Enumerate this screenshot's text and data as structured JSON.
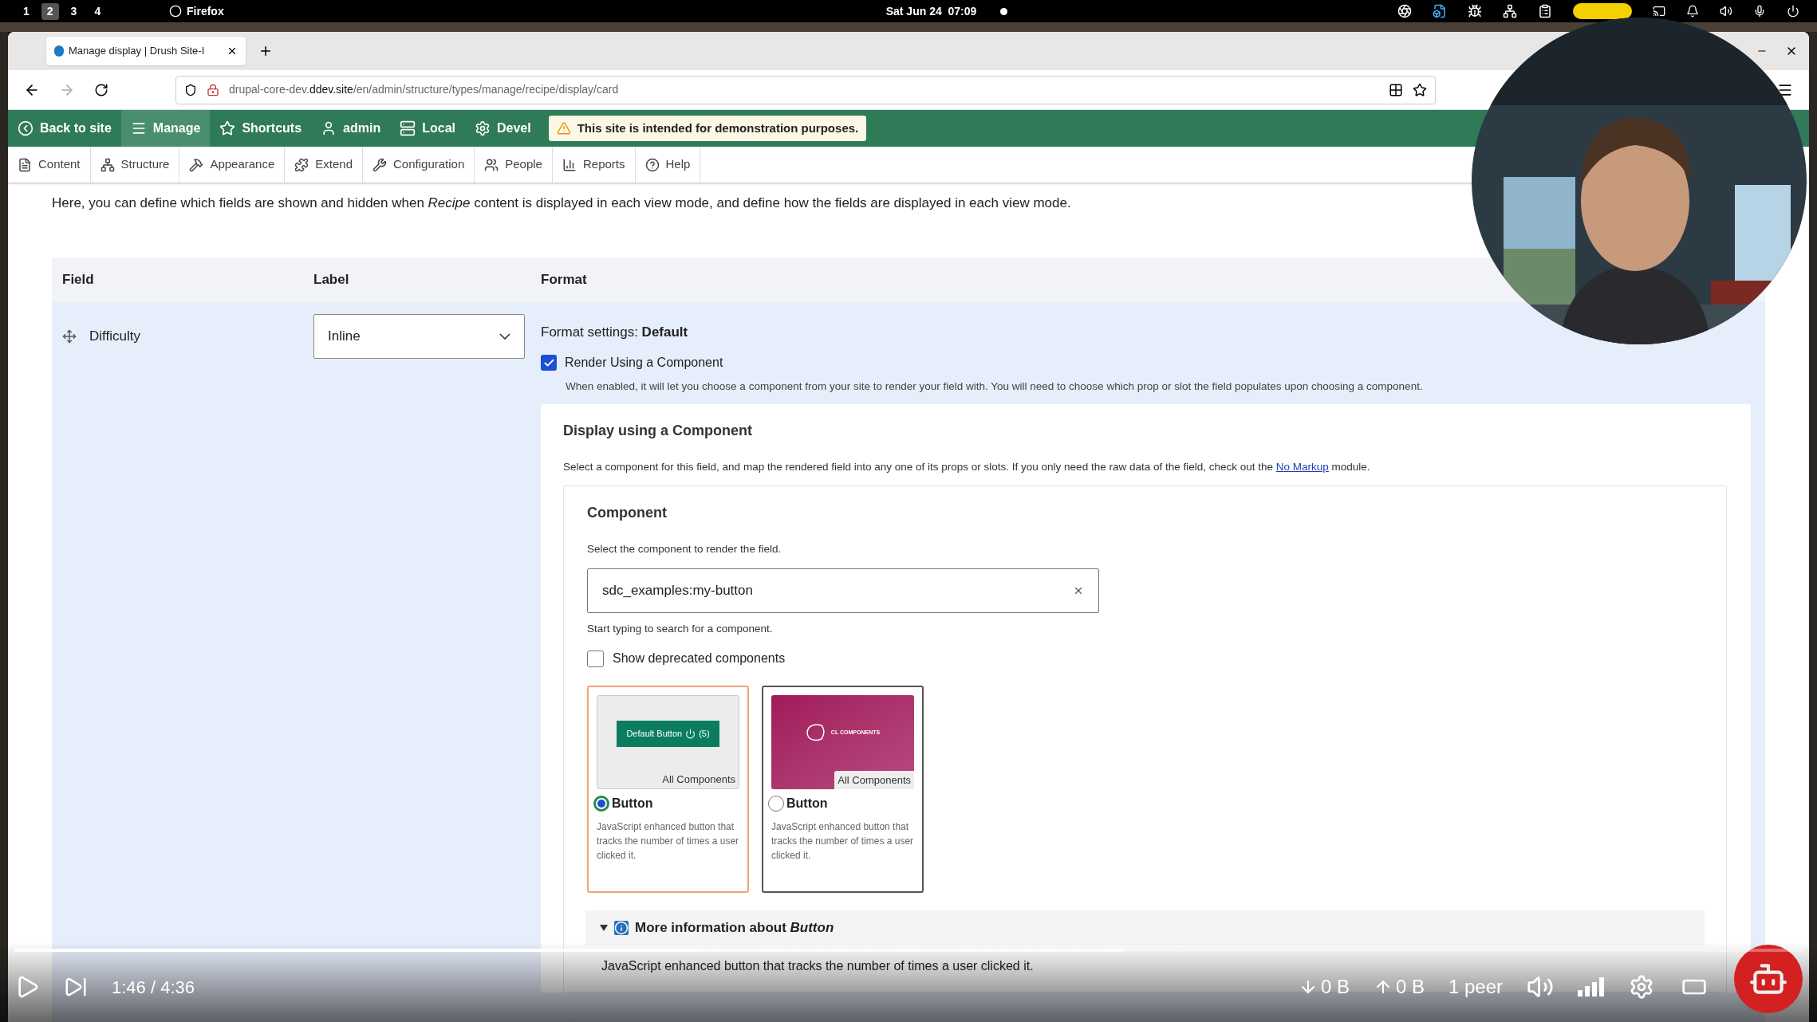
{
  "top_bar": {
    "workspaces": [
      {
        "label": "1",
        "selected": false
      },
      {
        "label": "2",
        "selected": true
      },
      {
        "label": "3",
        "selected": false
      },
      {
        "label": "4",
        "selected": false
      }
    ],
    "app": "Firefox",
    "clock": "Sat Jun 24  07:09"
  },
  "browser": {
    "tab_title": "Manage display | Drush Site-I",
    "url": {
      "prefix": "drupal-core-dev.",
      "domain": "ddev.site",
      "path": "/en/admin/structure/types/manage/recipe/display/card"
    }
  },
  "admin_toolbar": {
    "items": [
      {
        "label": "Back to site",
        "kind": "back",
        "selected": false
      },
      {
        "label": "Manage",
        "kind": "menu",
        "selected": true
      },
      {
        "label": "Shortcuts",
        "kind": "star",
        "selected": false
      },
      {
        "label": "admin",
        "kind": "user",
        "selected": false
      },
      {
        "label": "Local",
        "kind": "server",
        "selected": false
      },
      {
        "label": "Devel",
        "kind": "gear",
        "selected": false
      }
    ],
    "notice": "This site is intended for demonstration purposes."
  },
  "tray": [
    {
      "label": "Content",
      "kind": "file"
    },
    {
      "label": "Structure",
      "kind": "tree"
    },
    {
      "label": "Appearance",
      "kind": "brush"
    },
    {
      "label": "Extend",
      "kind": "puzzle"
    },
    {
      "label": "Configuration",
      "kind": "wrench"
    },
    {
      "label": "People",
      "kind": "people"
    },
    {
      "label": "Reports",
      "kind": "chart"
    },
    {
      "label": "Help",
      "kind": "help"
    }
  ],
  "description": "Here, you can define which fields are shown and hidden when *Recipe* content is displayed in each view mode, and define how the fields are displayed in each view mode.",
  "table": {
    "columns": [
      "Field",
      "Label",
      "Format"
    ],
    "row": {
      "field": "Difficulty",
      "label": "Inline",
      "format_settings": "Format settings: **Default**",
      "render": {
        "label": "Render Using a Component",
        "checked": true,
        "help": "When enabled, it will let you choose a component from your site to render your field with. You will need to choose which prop or slot the field populates upon choosing a component."
      },
      "panel": {
        "title": "Display using a Component",
        "text_before": "Select a component for this field, and map the rendered field into any one of its props or slots. If you only need the raw data of the field, check out the",
        "link": "No Markup",
        "text_after": "module.",
        "component": {
          "title": "Component",
          "help": "Select the component to render the field.",
          "value": "sdc_examples:my-button",
          "hint": "Start typing to search for a component.",
          "deprecated": {
            "label": "Show deprecated components",
            "checked": false
          },
          "cards": [
            {
              "kind": "default-button",
              "thumb_texts": [
                "Default Button",
                "(5)"
              ],
              "badge": "All Components",
              "title": "Button",
              "text": "JavaScript enhanced button that tracks the number of times a user clicked it.",
              "selected": true
            },
            {
              "kind": "cl-components",
              "thumb_texts": [
                "CL COMPONENTS"
              ],
              "badge": "All Components",
              "title": "Button",
              "text": "JavaScript enhanced button that tracks the number of times a user clicked it.",
              "selected": false
            }
          ],
          "more_info": {
            "title": "More information about *Button*",
            "expanded": true,
            "text": "JavaScript enhanced button that tracks the number of times a user clicked it."
          }
        }
      }
    }
  },
  "player": {
    "level": 0.38,
    "time": "1:46 / 4:36",
    "down": "0 B",
    "up": "0 B",
    "peers": "1 peer"
  }
}
